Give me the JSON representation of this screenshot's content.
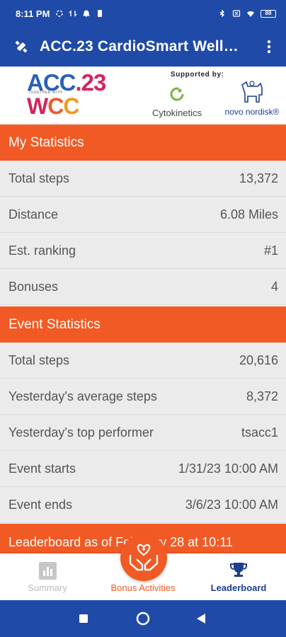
{
  "status_bar": {
    "time": "8:11 PM",
    "battery": "88"
  },
  "app_bar": {
    "title": "ACC.23 CardioSmart Well…"
  },
  "sponsor": {
    "acc_text": "ACC",
    "acc_num": ".23",
    "tagline": "TOGETHER WITH",
    "wcc_w": "W",
    "wcc_c1": "C",
    "wcc_c2": "C",
    "supported_by": "Supported by:",
    "cytokinetics": "Cytokinetics",
    "novo": "novo nordisk®"
  },
  "my_statistics": {
    "header": "My Statistics",
    "rows": [
      {
        "label": "Total steps",
        "value": "13,372"
      },
      {
        "label": "Distance",
        "value": "6.08 Miles"
      },
      {
        "label": "Est. ranking",
        "value": "#1"
      },
      {
        "label": "Bonuses",
        "value": "4"
      }
    ]
  },
  "event_statistics": {
    "header": "Event Statistics",
    "rows": [
      {
        "label": "Total steps",
        "value": "20,616"
      },
      {
        "label": "Yesterday's average steps",
        "value": "8,372"
      },
      {
        "label": "Yesterday's top performer",
        "value": "tsacc1"
      },
      {
        "label": "Event starts",
        "value": "1/31/23 10:00 AM"
      },
      {
        "label": "Event ends",
        "value": "3/6/23 10:00 AM"
      }
    ]
  },
  "footer_text": "Leaderboard as of February 28 at 10:11",
  "bottom_nav": {
    "summary": "Summary",
    "bonus": "Bonus Activities",
    "leaderboard": "Leaderboard"
  },
  "colors": {
    "primary": "#1f4aa8",
    "accent": "#f15a24",
    "row_bg": "#ebebeb"
  }
}
